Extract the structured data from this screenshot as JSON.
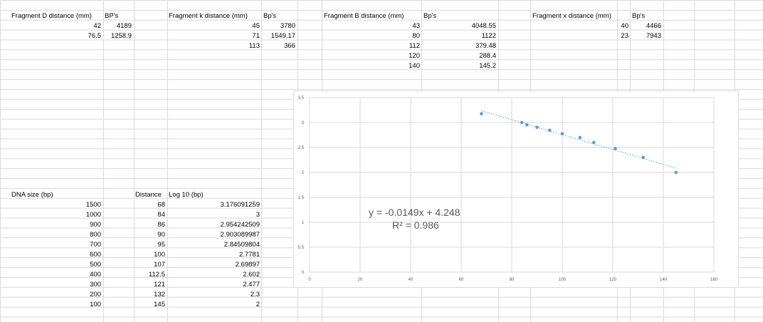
{
  "grid": {
    "columns": [
      0,
      145,
      188,
      235,
      367,
      418,
      452,
      592,
      700,
      745,
      867,
      885,
      932,
      975,
      1032,
      1072
    ]
  },
  "tables": {
    "fragD": {
      "header_distance": "Fragment D distance (mm)",
      "header_bp": "BP's",
      "rows": [
        [
          "42",
          "4189"
        ],
        [
          "76.5",
          "1258.9"
        ]
      ]
    },
    "fragK": {
      "header_distance": "Fragment k distance (mm)",
      "header_bp": "Bp's",
      "rows": [
        [
          "45",
          "3780"
        ],
        [
          "71",
          "1549.17"
        ],
        [
          "113",
          "366"
        ]
      ]
    },
    "fragB": {
      "header_distance": "Fragment B distance (mm)",
      "header_bp": "Bp's",
      "rows": [
        [
          "43",
          "4048.55"
        ],
        [
          "80",
          "1122"
        ],
        [
          "112",
          "379.48"
        ],
        [
          "120",
          "288.4"
        ],
        [
          "140",
          "145.2"
        ]
      ]
    },
    "fragX": {
      "header_distance": "Fragment x distance (mm)",
      "header_bp": "Bp's",
      "rows": [
        [
          "40",
          "4466"
        ],
        [
          "23",
          "7943"
        ]
      ]
    },
    "ladder": {
      "header_size": "DNA size (bp)",
      "header_distance": "Distance",
      "header_log": "Log 10 (bp)",
      "rows": [
        [
          "1500",
          "68",
          "3.176091259"
        ],
        [
          "1000",
          "84",
          "3"
        ],
        [
          "900",
          "86",
          "2.954242509"
        ],
        [
          "800",
          "90",
          "2.903089987"
        ],
        [
          "700",
          "95",
          "2.84509804"
        ],
        [
          "600",
          "100",
          "2.7781"
        ],
        [
          "500",
          "107",
          "2.69897"
        ],
        [
          "400",
          "112.5",
          "2.602"
        ],
        [
          "300",
          "121",
          "2.477"
        ],
        [
          "200",
          "132",
          "2.3"
        ],
        [
          "100",
          "145",
          "2"
        ]
      ]
    }
  },
  "chart_data": {
    "type": "scatter",
    "x": [
      68,
      84,
      86,
      90,
      95,
      100,
      107,
      112.5,
      121,
      132,
      145
    ],
    "y": [
      3.176091259,
      3,
      2.954242509,
      2.903089987,
      2.84509804,
      2.7781,
      2.69897,
      2.602,
      2.477,
      2.3,
      2
    ],
    "trendline": {
      "slope": -0.0149,
      "intercept": 4.248,
      "x_range": [
        68,
        145
      ],
      "style": "dotted"
    },
    "equation_text": "y = -0.0149x + 4.248",
    "r2_text": "R² = 0.986",
    "xlim": [
      0,
      160
    ],
    "ylim": [
      0,
      3.5
    ],
    "xticks": [
      "0",
      "20",
      "40",
      "60",
      "80",
      "100",
      "120",
      "140",
      "160"
    ],
    "yticks": [
      "0",
      "0.5",
      "1",
      "1.5",
      "2",
      "2.5",
      "3",
      "3.5"
    ],
    "grid": "both",
    "point_color": "#5b9bd5",
    "trend_color": "#5b9bd5"
  }
}
